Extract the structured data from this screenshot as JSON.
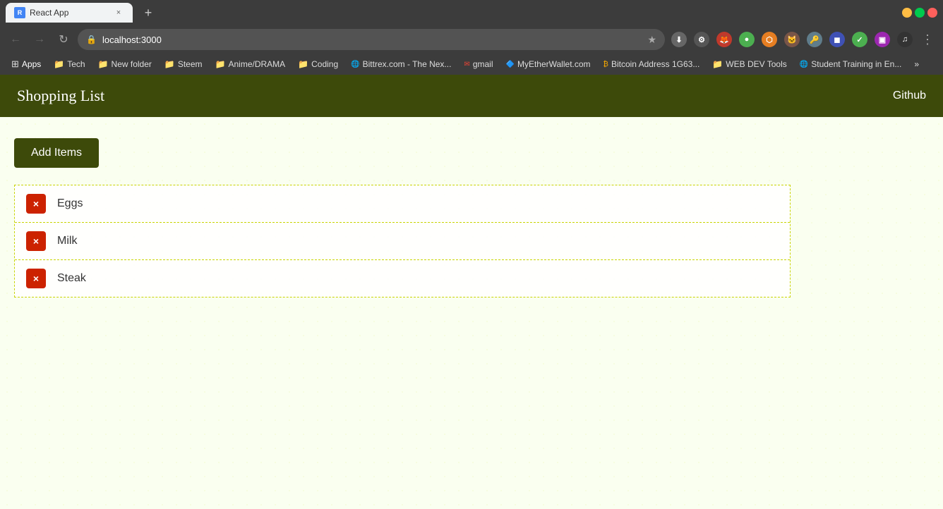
{
  "browser": {
    "tab": {
      "favicon_label": "R",
      "title": "React App",
      "close_label": "×"
    },
    "new_tab_label": "+",
    "window_controls": {
      "minimize": "−",
      "maximize": "□",
      "close": "×"
    },
    "nav": {
      "back": "←",
      "forward": "→",
      "reload": "↻",
      "home": "⌂"
    },
    "address": "localhost:3000",
    "star": "★",
    "more_label": "⋮"
  },
  "bookmarks": [
    {
      "label": "Apps",
      "color": "#4285f4",
      "icon": "⊞"
    },
    {
      "label": "Tech",
      "color": "#f9ab00"
    },
    {
      "label": "New folder",
      "color": "#f9ab00"
    },
    {
      "label": "Steem",
      "color": "#f9ab00"
    },
    {
      "label": "Anime/DRAMA",
      "color": "#f9ab00"
    },
    {
      "label": "Coding",
      "color": "#f9ab00"
    },
    {
      "label": "Bittrex.com - The Nex...",
      "color": "#4285f4"
    },
    {
      "label": "gmail",
      "color": "#ea4335"
    },
    {
      "label": "MyEtherWallet.com",
      "color": "#4285f4"
    },
    {
      "label": "Bitcoin Address 1G63...",
      "color": "#f9ab00"
    },
    {
      "label": "WEB DEV Tools",
      "color": "#f9ab00"
    },
    {
      "label": "Student Training in En...",
      "color": "#4285f4"
    },
    {
      "label": "»",
      "color": "#aaa"
    }
  ],
  "app": {
    "title": "Shopping List",
    "github_label": "Github"
  },
  "actions": {
    "add_items_label": "Add Items"
  },
  "shopping_list": {
    "items": [
      {
        "id": 1,
        "name": "Eggs",
        "delete_label": "×"
      },
      {
        "id": 2,
        "name": "Milk",
        "delete_label": "×"
      },
      {
        "id": 3,
        "name": "Steak",
        "delete_label": "×"
      }
    ]
  }
}
